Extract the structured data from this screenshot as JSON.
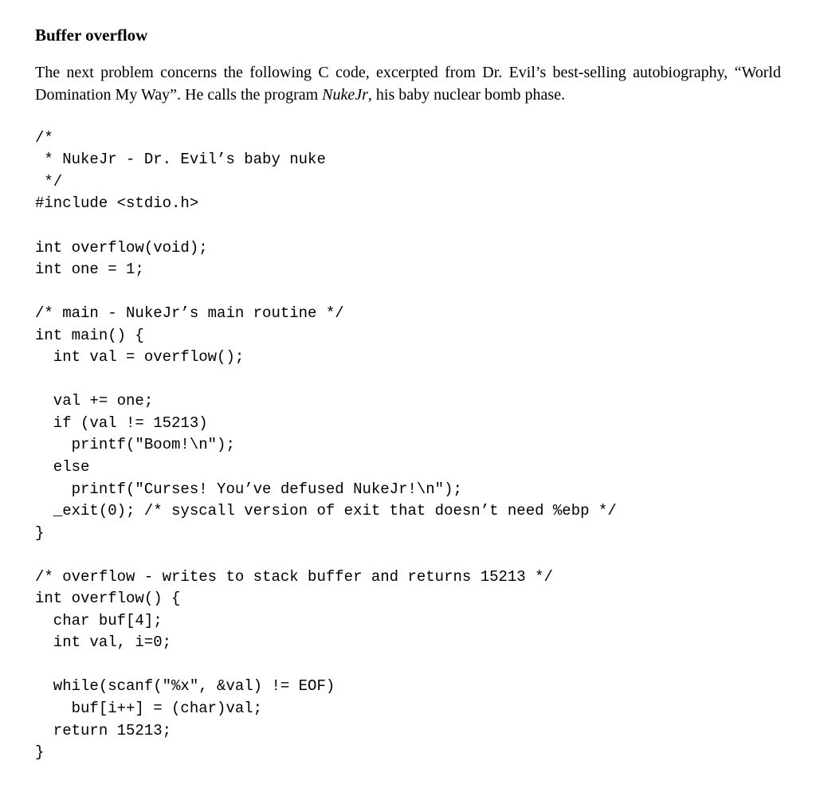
{
  "heading": "Buffer overflow",
  "intro_before": "The next problem concerns the following C code, excerpted from Dr. Evil’s best-selling autobiography, “World Domination My Way”. He calls the program ",
  "intro_program": "NukeJr",
  "intro_after": ", his baby nuclear bomb phase.",
  "code": "/*\n * NukeJr - Dr. Evil’s baby nuke\n */\n#include <stdio.h>\n\nint overflow(void);\nint one = 1;\n\n/* main - NukeJr’s main routine */\nint main() {\n  int val = overflow();\n\n  val += one;\n  if (val != 15213)\n    printf(\"Boom!\\n\");\n  else\n    printf(\"Curses! You’ve defused NukeJr!\\n\");\n  _exit(0); /* syscall version of exit that doesn’t need %ebp */\n}\n\n/* overflow - writes to stack buffer and returns 15213 */\nint overflow() {\n  char buf[4];\n  int val, i=0;\n\n  while(scanf(\"%x\", &val) != EOF)\n    buf[i++] = (char)val;\n  return 15213;\n}"
}
